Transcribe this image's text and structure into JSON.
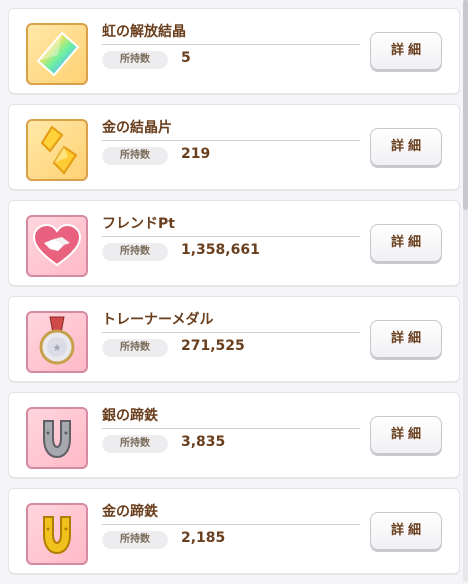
{
  "labels": {
    "owned": "所持数",
    "detail": "詳細"
  },
  "items": [
    {
      "name": "虹の解放結晶",
      "count": "5",
      "icon": "rainbow-crystal-icon",
      "bg": "gold"
    },
    {
      "name": "金の結晶片",
      "count": "219",
      "icon": "gold-crystal-shards-icon",
      "bg": "gold"
    },
    {
      "name": "フレンドPt",
      "count": "1,358,661",
      "icon": "handshake-heart-icon",
      "bg": "pink"
    },
    {
      "name": "トレーナーメダル",
      "count": "271,525",
      "icon": "trainer-medal-icon",
      "bg": "pink"
    },
    {
      "name": "銀の蹄鉄",
      "count": "3,835",
      "icon": "silver-horseshoe-icon",
      "bg": "pink"
    },
    {
      "name": "金の蹄鉄",
      "count": "2,185",
      "icon": "gold-horseshoe-icon",
      "bg": "pink"
    }
  ],
  "colors": {
    "text_brown": "#6a3f1e",
    "gold_bg": "#ffd072",
    "pink_bg": "#ffb8c6"
  }
}
